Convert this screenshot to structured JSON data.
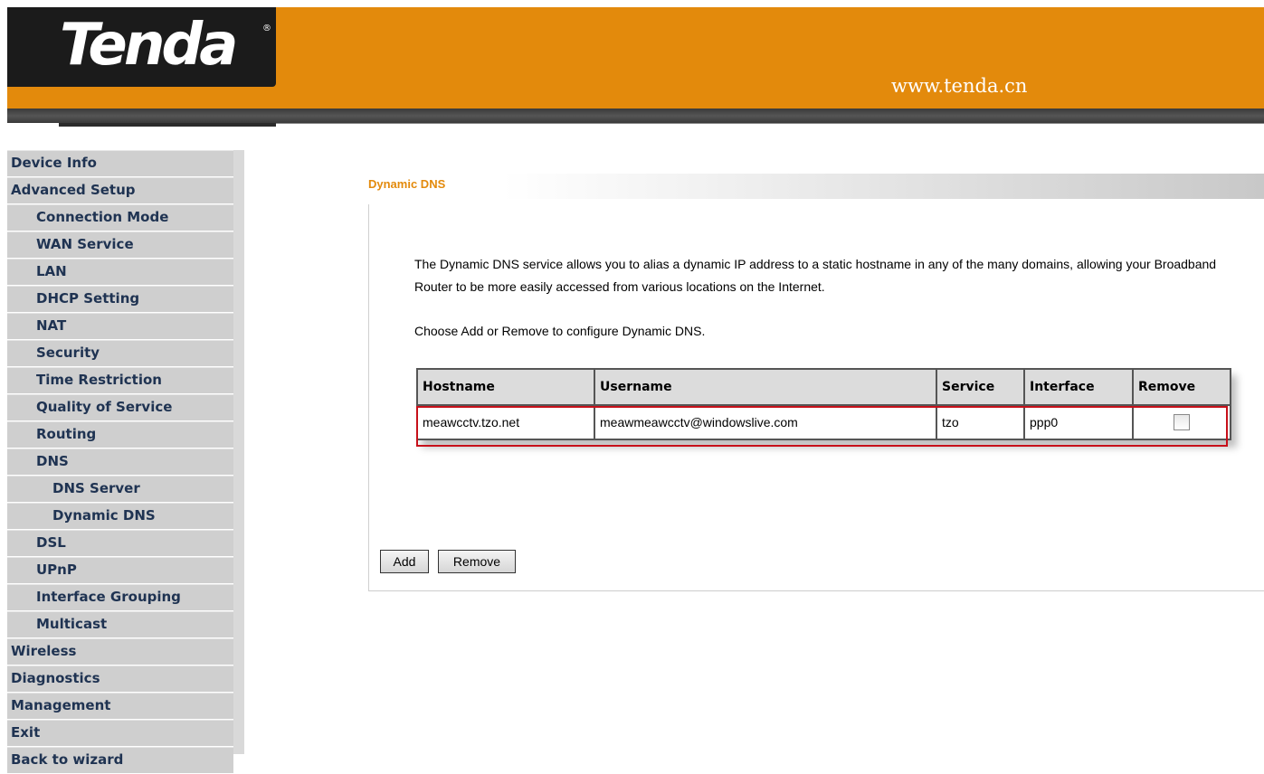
{
  "header": {
    "logo": "Tenda",
    "logo_mark": "®",
    "url": "www.tenda.cn"
  },
  "sidebar": {
    "items": [
      {
        "label": "Device Info",
        "level": 0
      },
      {
        "label": "Advanced Setup",
        "level": 0
      },
      {
        "label": "Connection Mode",
        "level": 1
      },
      {
        "label": "WAN Service",
        "level": 1
      },
      {
        "label": "LAN",
        "level": 1
      },
      {
        "label": "DHCP Setting",
        "level": 1
      },
      {
        "label": "NAT",
        "level": 1
      },
      {
        "label": "Security",
        "level": 1
      },
      {
        "label": "Time Restriction",
        "level": 1
      },
      {
        "label": "Quality of Service",
        "level": 1
      },
      {
        "label": "Routing",
        "level": 1
      },
      {
        "label": "DNS",
        "level": 1
      },
      {
        "label": "DNS Server",
        "level": 2
      },
      {
        "label": "Dynamic DNS",
        "level": 2
      },
      {
        "label": "DSL",
        "level": 1
      },
      {
        "label": "UPnP",
        "level": 1
      },
      {
        "label": "Interface Grouping",
        "level": 1
      },
      {
        "label": "Multicast",
        "level": 1
      },
      {
        "label": "Wireless",
        "level": 0
      },
      {
        "label": "Diagnostics",
        "level": 0
      },
      {
        "label": "Management",
        "level": 0
      },
      {
        "label": "Exit",
        "level": 0
      },
      {
        "label": "Back to wizard",
        "level": 0
      }
    ]
  },
  "main": {
    "section_title": "Dynamic DNS",
    "description": "The Dynamic DNS service allows you to alias a dynamic IP address to a static hostname in any of the many domains, allowing your Broadband Router to be more easily accessed from various locations on the Internet.",
    "instruction": "Choose Add or Remove to configure Dynamic DNS.",
    "table": {
      "headers": [
        "Hostname",
        "Username",
        "Service",
        "Interface",
        "Remove"
      ],
      "rows": [
        {
          "hostname": "meawcctv.tzo.net",
          "username": "meawmeawcctv@windowslive.com",
          "service": "tzo",
          "interface": "ppp0",
          "remove_checked": false
        }
      ]
    },
    "buttons": {
      "add": "Add",
      "remove": "Remove"
    },
    "highlight_color": "#c7101a"
  },
  "colors": {
    "brand_orange": "#e38a0c",
    "nav_text": "#1f3352",
    "nav_bg": "#cfcfcf"
  }
}
